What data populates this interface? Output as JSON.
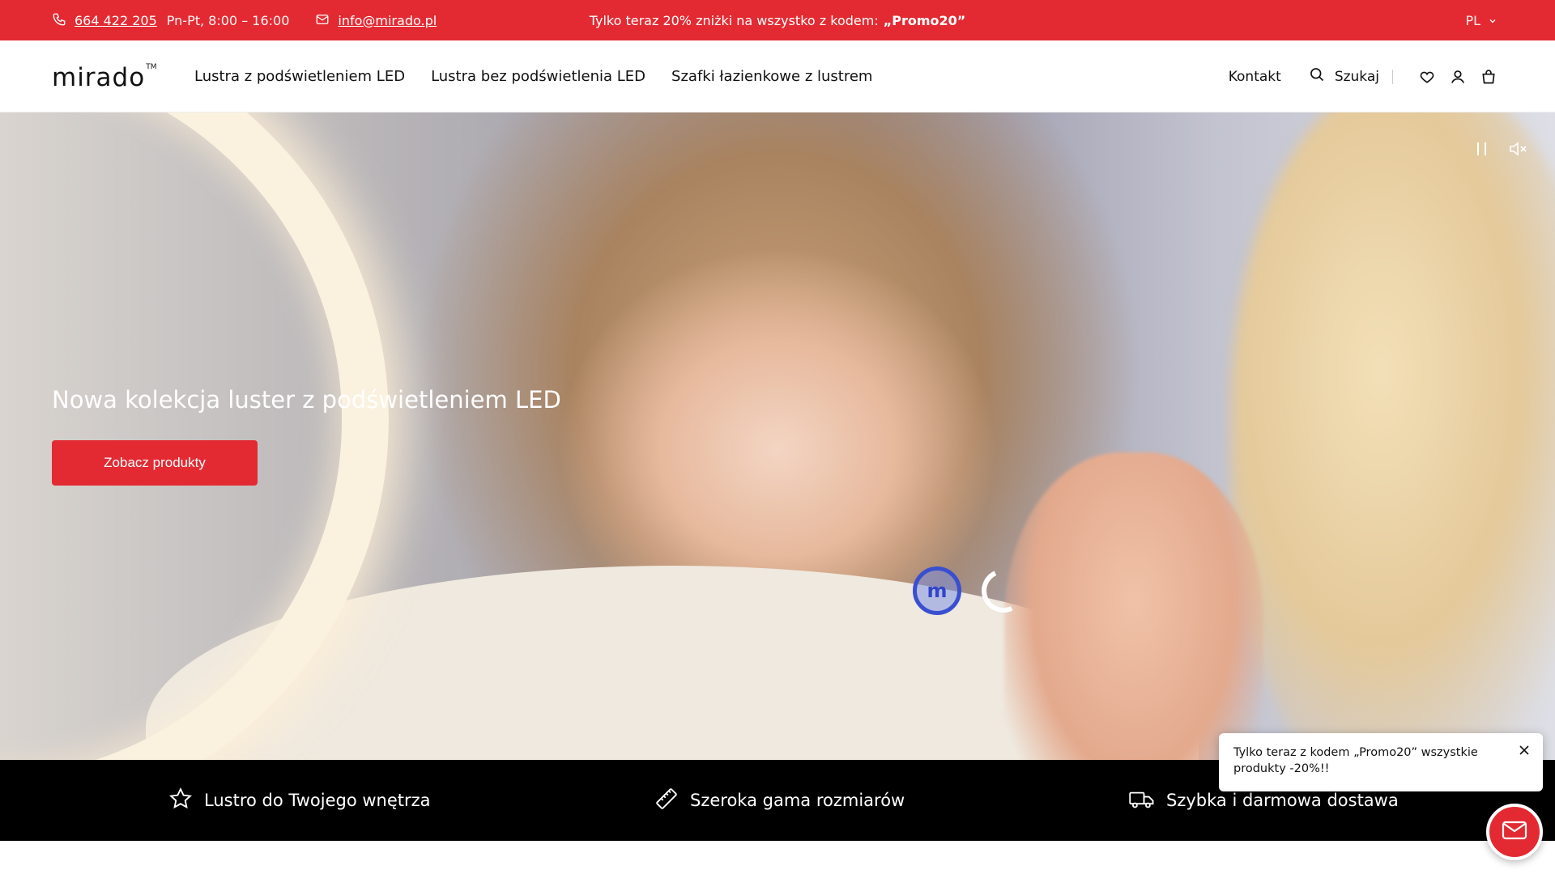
{
  "topbar": {
    "phone": "664 422 205",
    "hours": "Pn-Pt, 8:00 – 16:00",
    "email": "info@mirado.pl",
    "promo_text": "Tylko teraz 20% zniżki na wszystko z kodem:",
    "promo_code": "„Promo20”",
    "language": "PL"
  },
  "header": {
    "logo_text": "mirado",
    "logo_tm": "TM",
    "nav": [
      {
        "label": "Lustra z podświetleniem LED"
      },
      {
        "label": "Lustra bez podświetlenia LED"
      },
      {
        "label": "Szafki łazienkowe z lustrem"
      }
    ],
    "contact_label": "Kontakt",
    "search_label": "Szukaj"
  },
  "hero": {
    "title": "Nowa kolekcja luster z podświetleniem LED",
    "cta_label": "Zobacz produkty",
    "mirror_button_letter": "m"
  },
  "features": [
    {
      "label": "Lustro do Twojego wnętrza",
      "icon": "star-icon"
    },
    {
      "label": "Szeroka gama rozmiarów",
      "icon": "ruler-icon"
    },
    {
      "label": "Szybka i darmowa dostawa",
      "icon": "truck-icon"
    }
  ],
  "toast": {
    "text": "Tylko teraz z kodem „Promo20” wszystkie produkty -20%!!"
  },
  "colors": {
    "brand_red": "#e32a32",
    "feature_bar": "#000000"
  }
}
